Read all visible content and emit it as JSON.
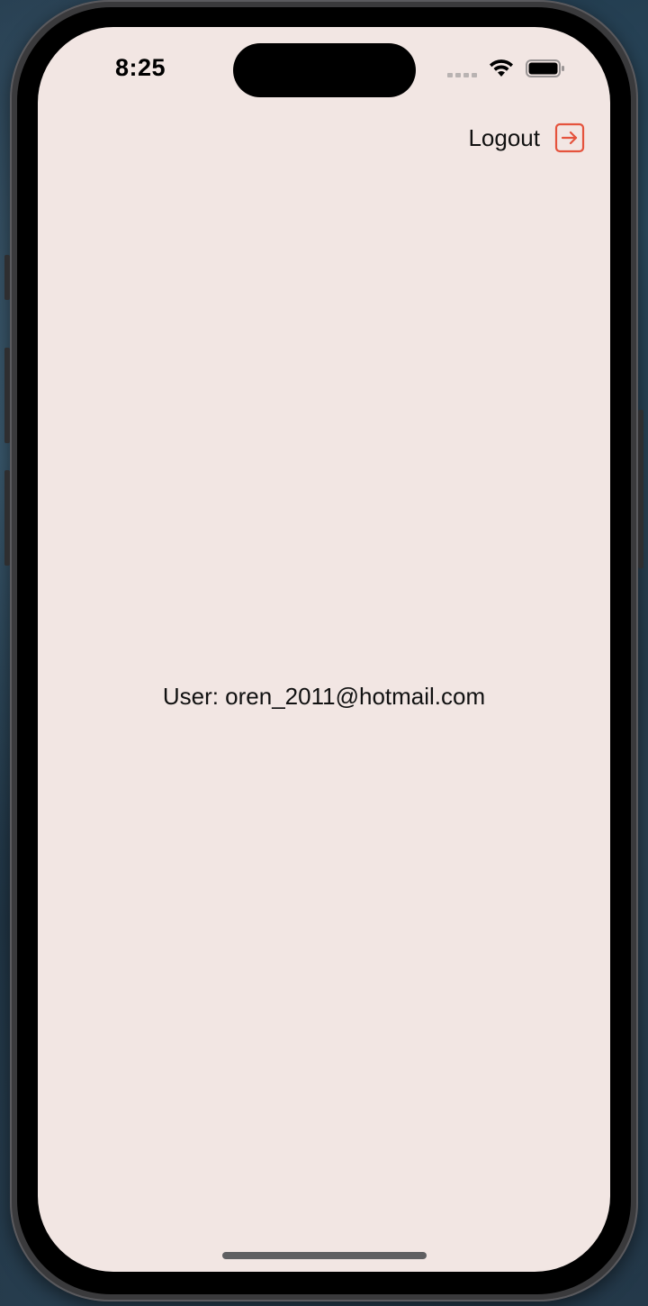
{
  "status_bar": {
    "time": "8:25",
    "icons": [
      "cellular-signal-icon",
      "wifi-icon",
      "battery-icon"
    ]
  },
  "header": {
    "logout_label": "Logout",
    "logout_icon": "logout-arrow-icon",
    "accent_color": "#e5533d"
  },
  "main": {
    "user_label": "User: oren_2011@hotmail.com"
  },
  "colors": {
    "screen_background": "#f2e6e3",
    "text": "#111111"
  }
}
